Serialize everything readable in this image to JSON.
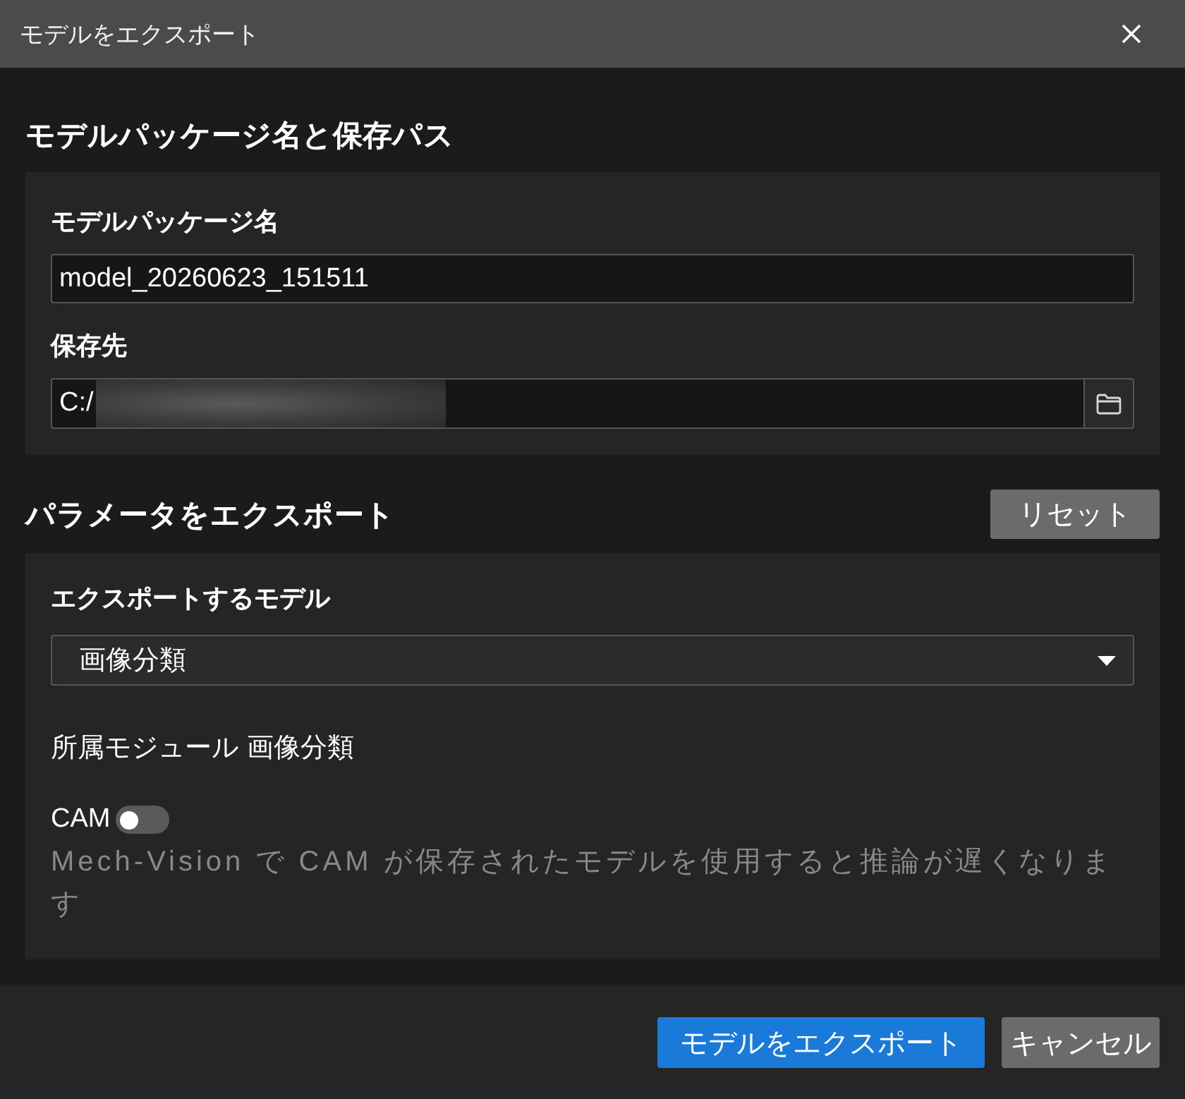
{
  "window": {
    "title": "モデルをエクスポート"
  },
  "package_section": {
    "heading": "モデルパッケージ名と保存パス",
    "name_field": {
      "label": "モデルパッケージ名",
      "value": "model_20260623_151511"
    },
    "path_field": {
      "label": "保存先",
      "value": "C:/",
      "redacted": true
    }
  },
  "parameters_section": {
    "heading": "パラメータをエクスポート",
    "reset_button": "リセット",
    "model_select": {
      "label": "エクスポートするモデル",
      "value": "画像分類"
    },
    "module": {
      "label": "所属モジュール",
      "value": "画像分類"
    },
    "cam_toggle": {
      "label": "CAM",
      "on": false
    },
    "hint": "Mech-Vision で CAM が保存されたモデルを使用すると推論が遅くなります"
  },
  "buttons": [
    {
      "label": "モデルをエクスポート",
      "kind": "primary"
    },
    {
      "label": "キャンセル",
      "kind": "secondary"
    }
  ]
}
